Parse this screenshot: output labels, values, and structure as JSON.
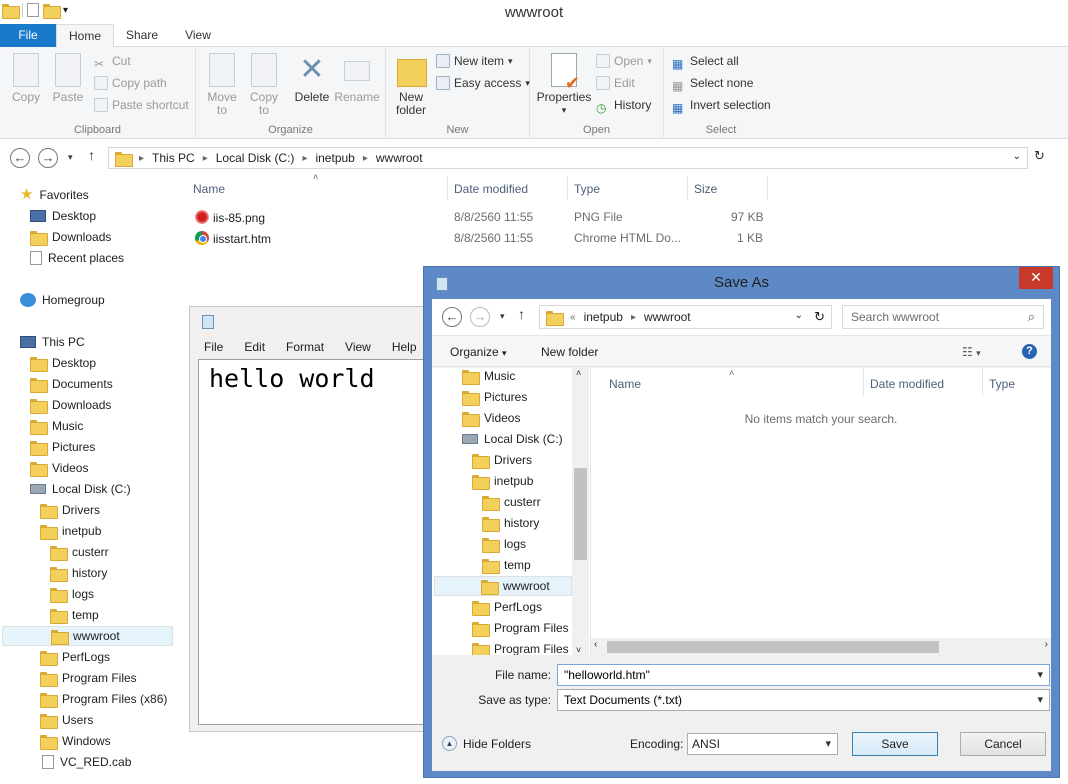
{
  "window": {
    "title": "wwwroot"
  },
  "ribbon": {
    "tabs": [
      "File",
      "Home",
      "Share",
      "View"
    ],
    "clipboard": {
      "label": "Clipboard",
      "copy": "Copy",
      "paste": "Paste",
      "cut": "Cut",
      "copy_path": "Copy path",
      "paste_shortcut": "Paste shortcut"
    },
    "organize": {
      "label": "Organize",
      "move_to_1": "Move",
      "move_to_2": "to",
      "copy_to_1": "Copy",
      "copy_to_2": "to",
      "delete": "Delete",
      "rename": "Rename"
    },
    "new": {
      "label": "New",
      "new_folder_1": "New",
      "new_folder_2": "folder",
      "new_item": "New item",
      "easy_access": "Easy access"
    },
    "open": {
      "label": "Open",
      "properties": "Properties",
      "open": "Open",
      "edit": "Edit",
      "history": "History"
    },
    "select": {
      "label": "Select",
      "select_all": "Select all",
      "select_none": "Select none",
      "invert": "Invert selection"
    }
  },
  "address": {
    "crumbs": [
      "This PC",
      "Local Disk (C:)",
      "inetpub",
      "wwwroot"
    ]
  },
  "navpane": {
    "favorites": "Favorites",
    "desktop": "Desktop",
    "downloads": "Downloads",
    "recent": "Recent places",
    "homegroup": "Homegroup",
    "thispc": "This PC",
    "pc_desktop": "Desktop",
    "documents": "Documents",
    "pc_downloads": "Downloads",
    "music": "Music",
    "pictures": "Pictures",
    "videos": "Videos",
    "localdisk": "Local Disk (C:)",
    "drivers": "Drivers",
    "inetpub": "inetpub",
    "custerr": "custerr",
    "history": "history",
    "logs": "logs",
    "temp": "temp",
    "wwwroot": "wwwroot",
    "perflogs": "PerfLogs",
    "programfiles": "Program Files",
    "programfiles86": "Program Files (x86)",
    "users": "Users",
    "windows": "Windows",
    "vcred": "VC_RED.cab"
  },
  "filelist": {
    "columns": {
      "name": "Name",
      "date": "Date modified",
      "type": "Type",
      "size": "Size"
    },
    "rows": [
      {
        "name": "iis-85.png",
        "date": "8/8/2560 11:55",
        "type": "PNG File",
        "size": "97 KB"
      },
      {
        "name": "iisstart.htm",
        "date": "8/8/2560 11:55",
        "type": "Chrome HTML Do...",
        "size": "1 KB"
      }
    ]
  },
  "notepad": {
    "menu": [
      "File",
      "Edit",
      "Format",
      "View",
      "Help"
    ],
    "content": "hello world"
  },
  "dialog": {
    "title": "Save As",
    "crumbs": [
      "inetpub",
      "wwwroot"
    ],
    "search_placeholder": "Search wwwroot",
    "organize": "Organize",
    "new_folder": "New folder",
    "tree": {
      "music": "Music",
      "pictures": "Pictures",
      "videos": "Videos",
      "localdisk": "Local Disk (C:)",
      "drivers": "Drivers",
      "inetpub": "inetpub",
      "custerr": "custerr",
      "history": "history",
      "logs": "logs",
      "temp": "temp",
      "wwwroot": "wwwroot",
      "perflogs": "PerfLogs",
      "programfiles": "Program Files",
      "programfiles86": "Program Files ("
    },
    "columns": {
      "name": "Name",
      "date": "Date modified",
      "type": "Type"
    },
    "empty": "No items match your search.",
    "filename_label": "File name:",
    "filename_value": "\"helloworld.htm\"",
    "savetype_label": "Save as type:",
    "savetype_value": "Text Documents (*.txt)",
    "hide_folders": "Hide Folders",
    "encoding_label": "Encoding:",
    "encoding_value": "ANSI",
    "save": "Save",
    "cancel": "Cancel"
  }
}
